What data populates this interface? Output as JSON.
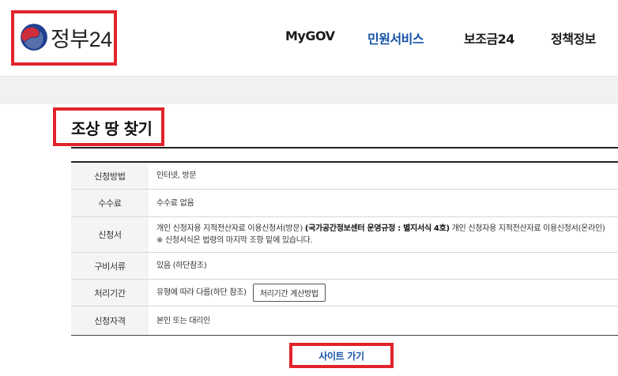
{
  "colors": {
    "accent_blue": "#1553a6",
    "highlight_red": "#e0242a",
    "band_gray": "#f0f1f3",
    "taeguk_red": "#cd2e3a",
    "taeguk_blue": "#1f3f8f"
  },
  "header": {
    "logo_text": "정부24",
    "logo_icon": "taeguk-emblem-icon",
    "nav": [
      {
        "label": "MyGOV",
        "active": false
      },
      {
        "label": "민원서비스",
        "active": true
      },
      {
        "label": "보조금24",
        "active": false
      },
      {
        "label": "정책정보",
        "active": false
      }
    ]
  },
  "page": {
    "title": "조상 땅 찾기"
  },
  "info_table": {
    "rows": [
      {
        "label": "신청방법",
        "lines": [
          "인터넷, 방문"
        ]
      },
      {
        "label": "수수료",
        "lines": [
          "수수료 없음"
        ]
      },
      {
        "label": "신청서",
        "line1_a": "개인 신청자용 지적전산자료 이용신청서(방문) ",
        "line1_b": "(국가공간정보센터 운영규정 : 별지서식 4호)",
        "line1_c": " 개인 신청자용 지적전산자료 이용신청서(온라인)",
        "line2": "※ 신청서식은 법령의 마지막 조항 밑에 있습니다."
      },
      {
        "label": "구비서류",
        "lines": [
          "있음 (하단참조)"
        ]
      },
      {
        "label": "처리기간",
        "text": "유형에 따라 다름(하단 참조)",
        "button": "처리기간 계산방법"
      },
      {
        "label": "신청자격",
        "lines": [
          "본인 또는 대리인"
        ]
      }
    ]
  },
  "go_button": {
    "label": "사이트 가기"
  }
}
